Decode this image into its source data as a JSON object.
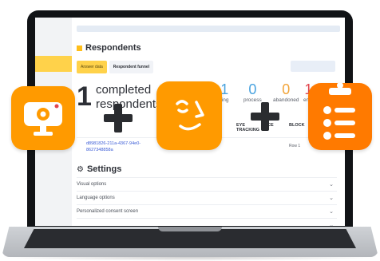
{
  "header": {
    "title": "Respondents"
  },
  "tabs": [
    {
      "label": "Answer data",
      "active": true
    },
    {
      "label": "Respondent funnel",
      "active": false
    }
  ],
  "summary": {
    "completed_count": "1",
    "completed_label_line1": "completed",
    "completed_label_line2": "respondents"
  },
  "stats": [
    {
      "value": "1",
      "label": "ting",
      "color": "#4aa3df"
    },
    {
      "value": "0",
      "label": "process",
      "color": "#4aa3df"
    },
    {
      "value": "0",
      "label": "abandoned",
      "color": "#f2a53a"
    },
    {
      "value": "1",
      "label": "emu",
      "color": "#e2464e"
    }
  ],
  "table": {
    "headers": [
      "EYE TRACKING",
      "CE",
      "BLOCK",
      "S"
    ],
    "row": {
      "id": "d8981826-211a-4367-94e0-8627348858a",
      "block": "Row 1"
    }
  },
  "settings": {
    "title": "Settings",
    "items": [
      "Visual options",
      "Language options",
      "Personalized consent screen",
      ""
    ]
  },
  "overlay_icons": [
    "webcam-icon",
    "face-icon",
    "clipboard-checklist-icon"
  ],
  "colors": {
    "accent": "#ff9a00",
    "accent_dark": "#ff7a00",
    "tab_active": "#ffd24a"
  }
}
